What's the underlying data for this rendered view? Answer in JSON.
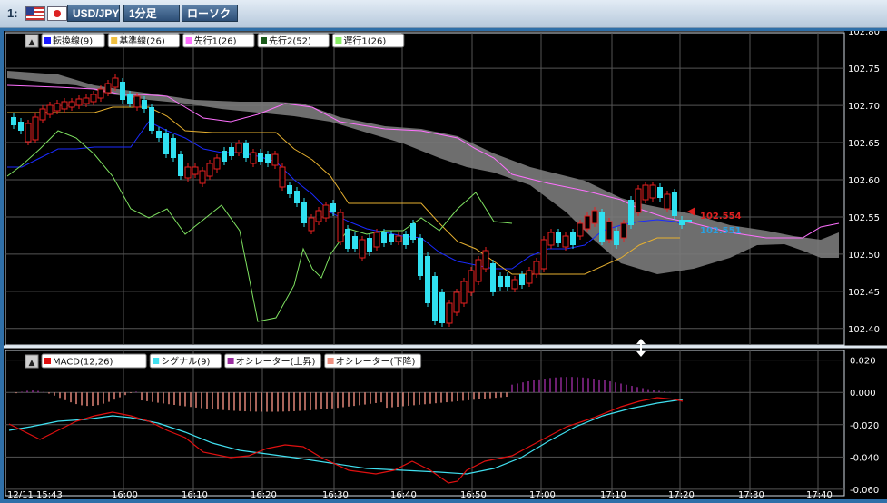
{
  "window": {
    "number": "1:",
    "symbol": "USD/JPY",
    "timeframe": "1分足",
    "chart_type": "ローソク",
    "flag_icons": [
      "us-flag-icon",
      "japan-flag-icon"
    ]
  },
  "main_legend": [
    {
      "label": "転換線(9)",
      "color": "#1a1aff"
    },
    {
      "label": "基準線(26)",
      "color": "#f0c040"
    },
    {
      "label": "先行1(26)",
      "color": "#ff70ff"
    },
    {
      "label": "先行2(52)",
      "color": "#1a5a1a"
    },
    {
      "label": "遅行1(26)",
      "color": "#88ee66"
    }
  ],
  "macd_legend": [
    {
      "label": "MACD(12,26)",
      "color": "#e01010"
    },
    {
      "label": "シグナル(9)",
      "color": "#40e0f0"
    },
    {
      "label": "オシレーター(上昇)",
      "color": "#9a2ca0"
    },
    {
      "label": "オシレーター(下降)",
      "color": "#f09080"
    }
  ],
  "price_axis": [
    "102.80",
    "102.75",
    "102.70",
    "102.65",
    "102.60",
    "102.55",
    "102.50",
    "102.45",
    "102.40"
  ],
  "macd_axis": [
    "0.020",
    "0.000",
    "-0.020",
    "-0.040",
    "-0.060"
  ],
  "time_axis": [
    "12/11 15:43",
    "16:00",
    "16:10",
    "16:20",
    "16:30",
    "16:40",
    "16:50",
    "17:00",
    "17:10",
    "17:20",
    "17:30",
    "17:40"
  ],
  "bid_price": "102.554",
  "ask_price": "102.551",
  "colors": {
    "up": "#e82020",
    "down": "#30e0f0",
    "cloud": "#808080",
    "bid": "#e02020",
    "ask": "#2aa0e0"
  },
  "chart_data": {
    "type": "candlestick",
    "symbol": "USD/JPY",
    "interval": "1 minute",
    "ylim": [
      102.39,
      102.81
    ],
    "ohlc_close_approx": [
      102.69,
      102.68,
      102.67,
      102.7,
      102.71,
      102.72,
      102.72,
      102.73,
      102.74,
      102.76,
      102.74,
      102.72,
      102.71,
      102.69,
      102.65,
      102.62,
      102.6,
      102.61,
      102.63,
      102.65,
      102.66,
      102.64,
      102.62,
      102.6,
      102.57,
      102.53,
      102.55,
      102.56,
      102.52,
      102.5,
      102.53,
      102.55,
      102.52,
      102.47,
      102.42,
      102.46,
      102.5,
      102.49,
      102.47,
      102.48,
      102.5,
      102.53,
      102.54,
      102.55,
      102.56,
      102.58,
      102.57,
      102.59,
      102.6,
      102.58,
      102.555
    ]
  }
}
